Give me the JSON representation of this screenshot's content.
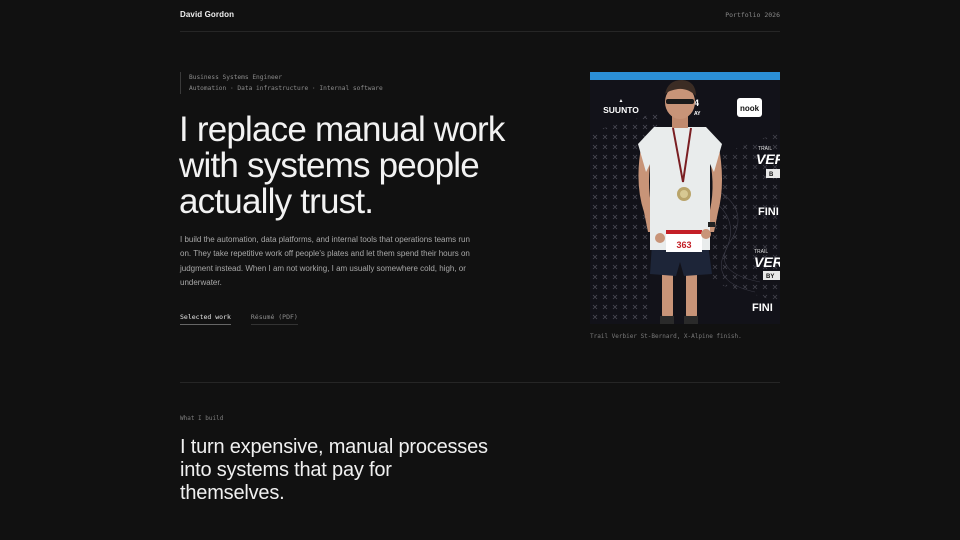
{
  "header": {
    "brand": "David Gordon",
    "meta": "Portfolio 2026"
  },
  "hero": {
    "eyebrow_role": "Business Systems Engineer",
    "eyebrow_tags": "Automation · Data infrastructure · Internal software",
    "title_lines": [
      "I replace manual work",
      "with systems people",
      "actually trust."
    ],
    "body": "I build the automation, data platforms, and internal tools that operations teams run on. They take repetitive work off people's plates and let them spend their hours on judgment instead. When I am not working, I am usually somewhere cold, high, or underwater.",
    "cta_primary": "Selected work",
    "cta_secondary": "Résumé (PDF)"
  },
  "photo": {
    "sponsor_left": "SUUNTO",
    "sponsor_right": "nook",
    "backdrop_fragment_1": "4",
    "backdrop_fragment_2": "AY",
    "backdrop_trail_1": "TRAIL",
    "backdrop_big_1": "VER",
    "backdrop_small_1": "B",
    "backdrop_finish_1": "FINI",
    "backdrop_trail_2": "TRAIL",
    "backdrop_big_2": "VER",
    "backdrop_small_2": "BY",
    "backdrop_finish_2": "FINI",
    "bib_number": "363",
    "caption": "Trail Verbier St-Bernard, X-Alpine finish.",
    "accent_color": "#2b8fd6"
  },
  "section": {
    "label": "What I build",
    "title": "I turn expensive, manual processes into systems that pay for themselves."
  }
}
